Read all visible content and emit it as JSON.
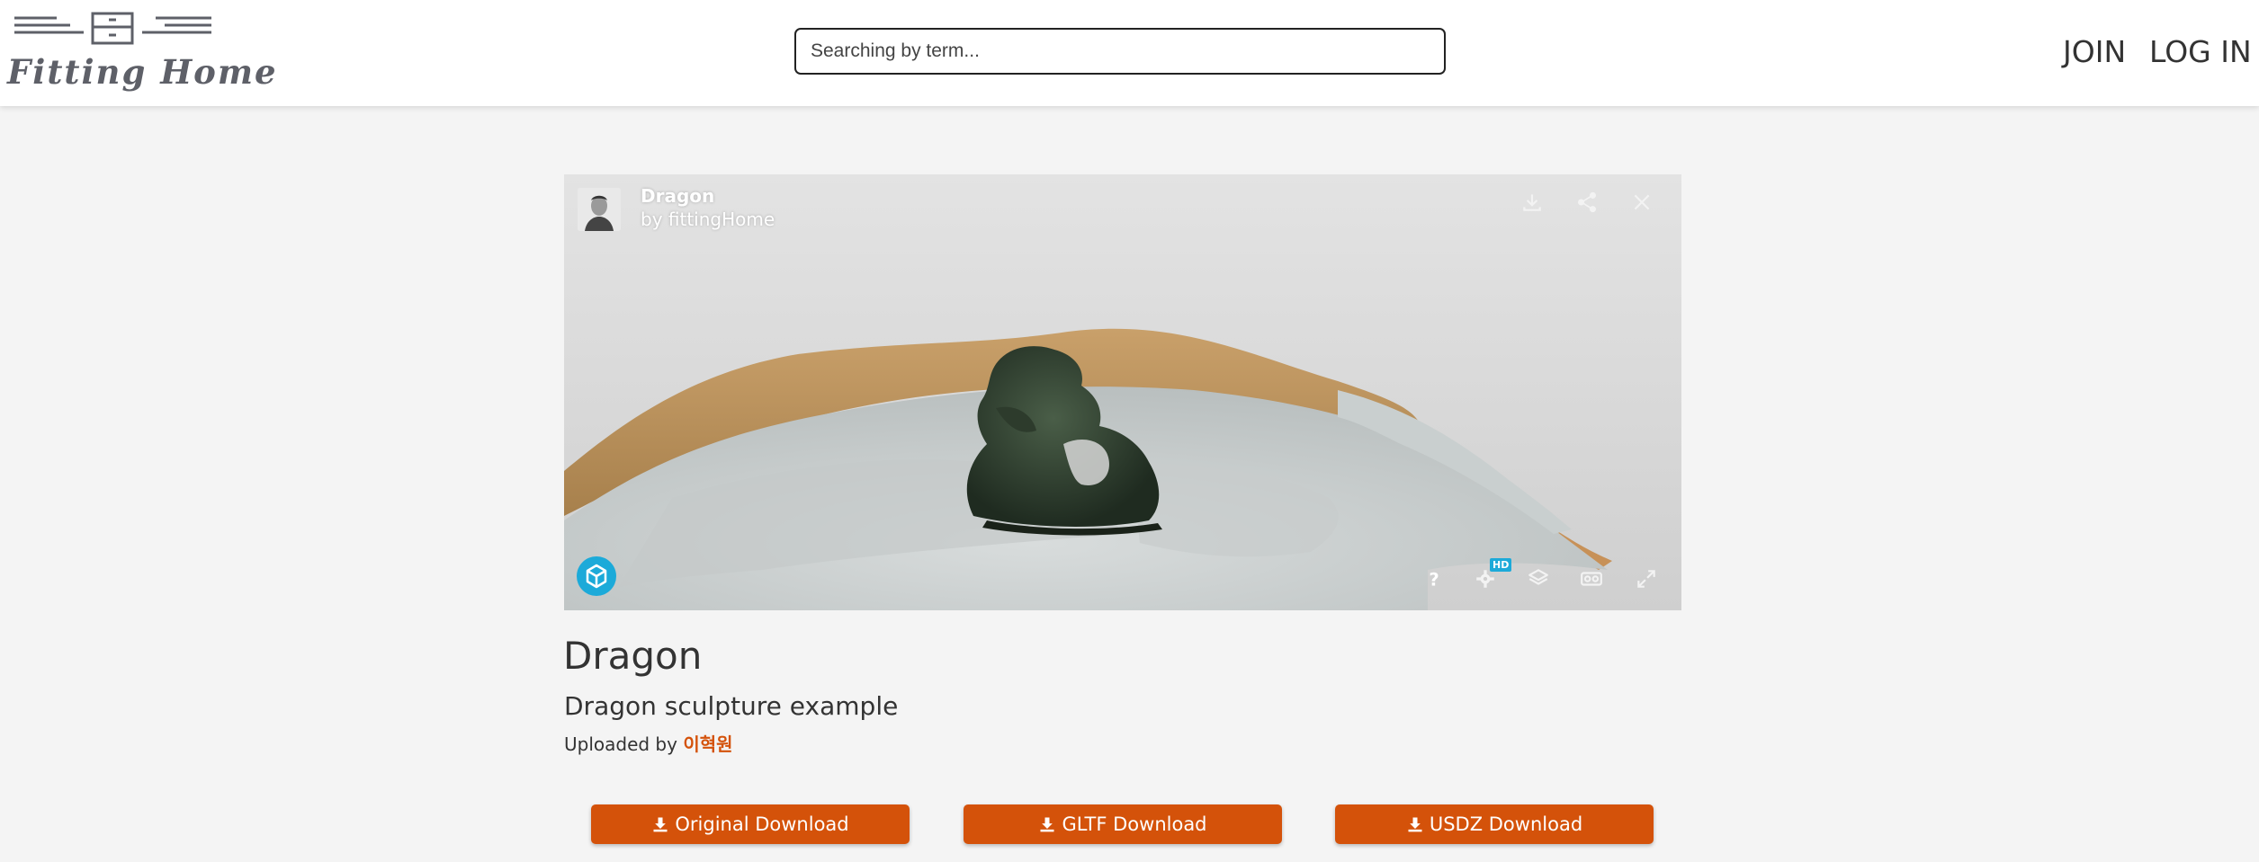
{
  "header": {
    "logo_text": "Fitting Home",
    "search_placeholder": "Searching by term...",
    "nav": {
      "join": "JOIN",
      "login": "LOG IN"
    }
  },
  "viewer": {
    "title": "Dragon",
    "by_prefix": "by",
    "author": "fittingHome",
    "hd_badge": "HD",
    "icons": [
      "download-icon",
      "share-icon",
      "close-icon",
      "help-icon",
      "settings-icon",
      "layers-icon",
      "vr-icon",
      "fullscreen-icon"
    ]
  },
  "model": {
    "title": "Dragon",
    "description": "Dragon sculpture example",
    "uploaded_by_label": "Uploaded by",
    "uploader": "이혁원"
  },
  "downloads": [
    {
      "label": "Original Download"
    },
    {
      "label": "GLTF Download"
    },
    {
      "label": "USDZ Download"
    }
  ],
  "colors": {
    "accent": "#d4520a",
    "viewer_brand": "#1caad9",
    "page_bg": "#f4f4f4"
  }
}
